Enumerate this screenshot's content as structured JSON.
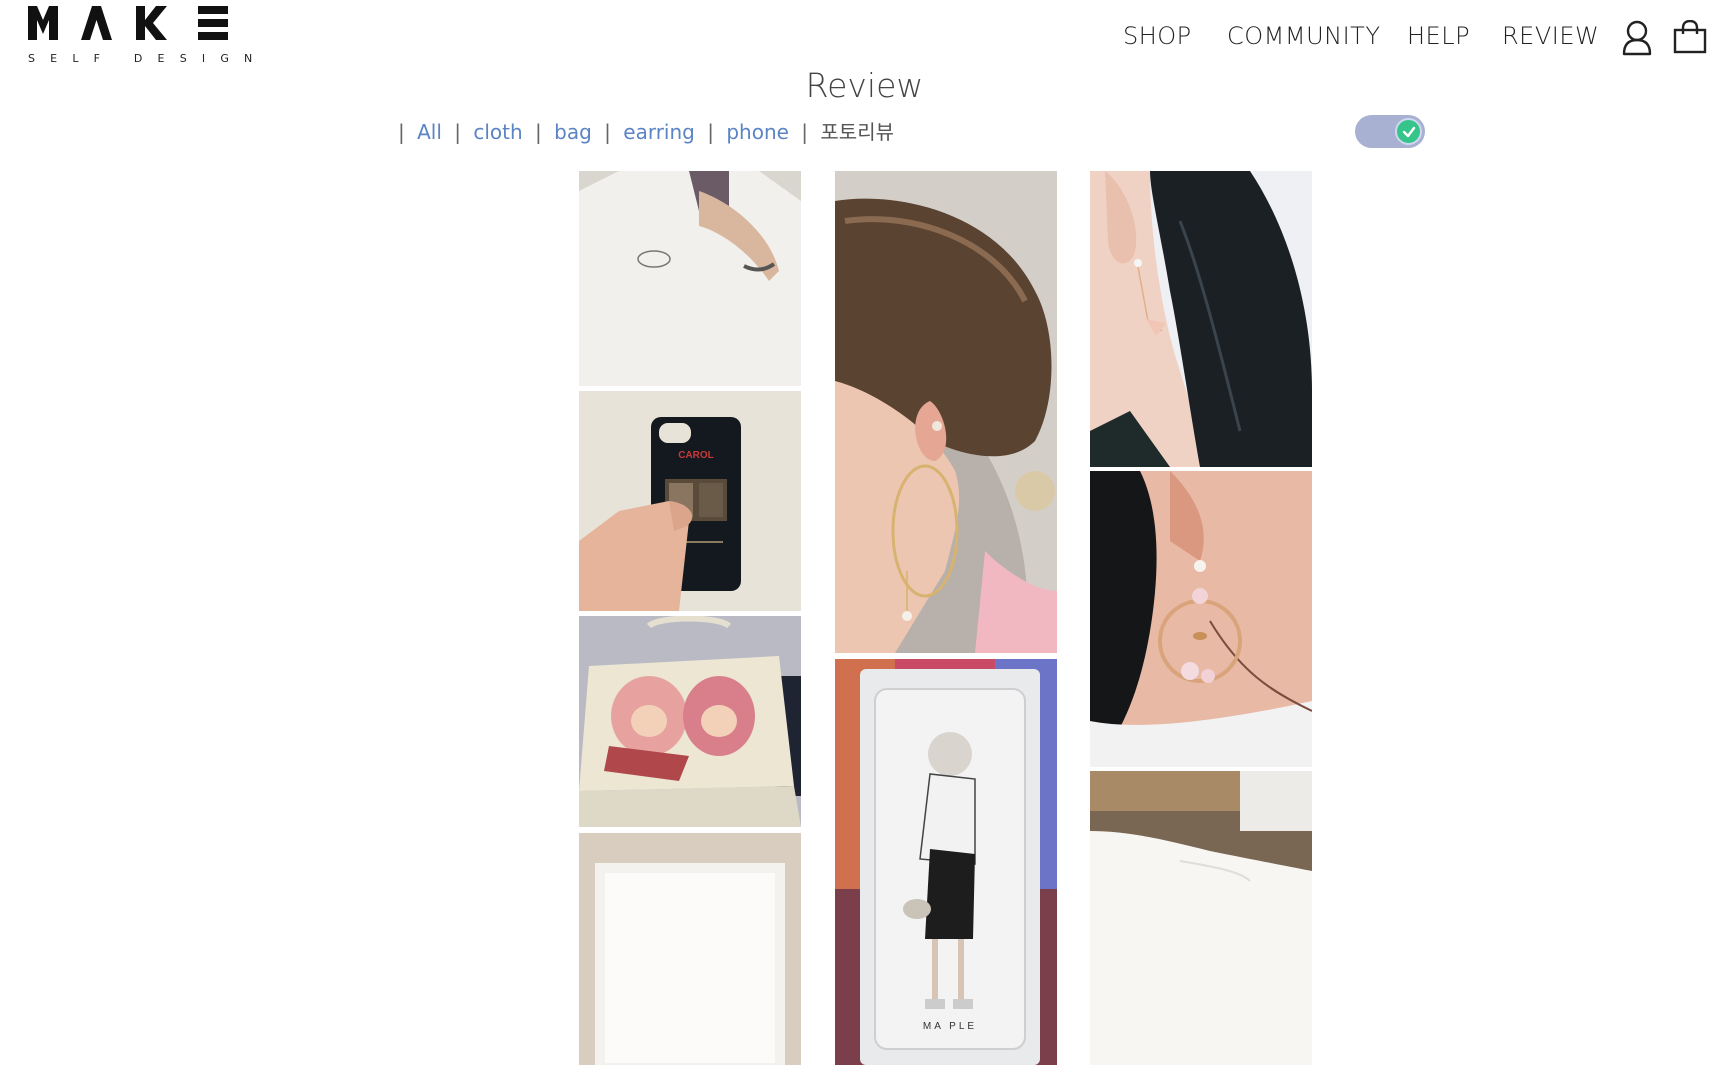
{
  "logo": {
    "mark": "MAKE",
    "subtitle": "SELF DESIGN"
  },
  "nav": {
    "shop": "SHOP",
    "community": "COMMUNITY",
    "help": "HELP",
    "review": "REVIEW",
    "account_icon": "user-icon",
    "cart_icon": "shopping-bag-icon"
  },
  "page": {
    "title": "Review"
  },
  "filters": {
    "sep": "|",
    "items": [
      "All",
      "cloth",
      "bag",
      "earring",
      "phone",
      "포토리뷰"
    ]
  },
  "toggle": {
    "state": "on",
    "accent": "#35c58a",
    "track": "#a9b1d3"
  },
  "photo_case": {
    "brand": "CAROL",
    "case_brand": "MA PLE"
  },
  "gallery": {
    "columns": [
      [
        "white t-shirt photo",
        "phone case photo",
        "tote bag photo",
        "packaged item photo"
      ],
      [
        "hoop earring photo",
        "clear phone case photo"
      ],
      [
        "drop earring photo",
        "flower hoop earring photo",
        "white t-shirt photo"
      ]
    ]
  },
  "colors": {
    "link": "#5b84c4",
    "text": "#222222"
  }
}
